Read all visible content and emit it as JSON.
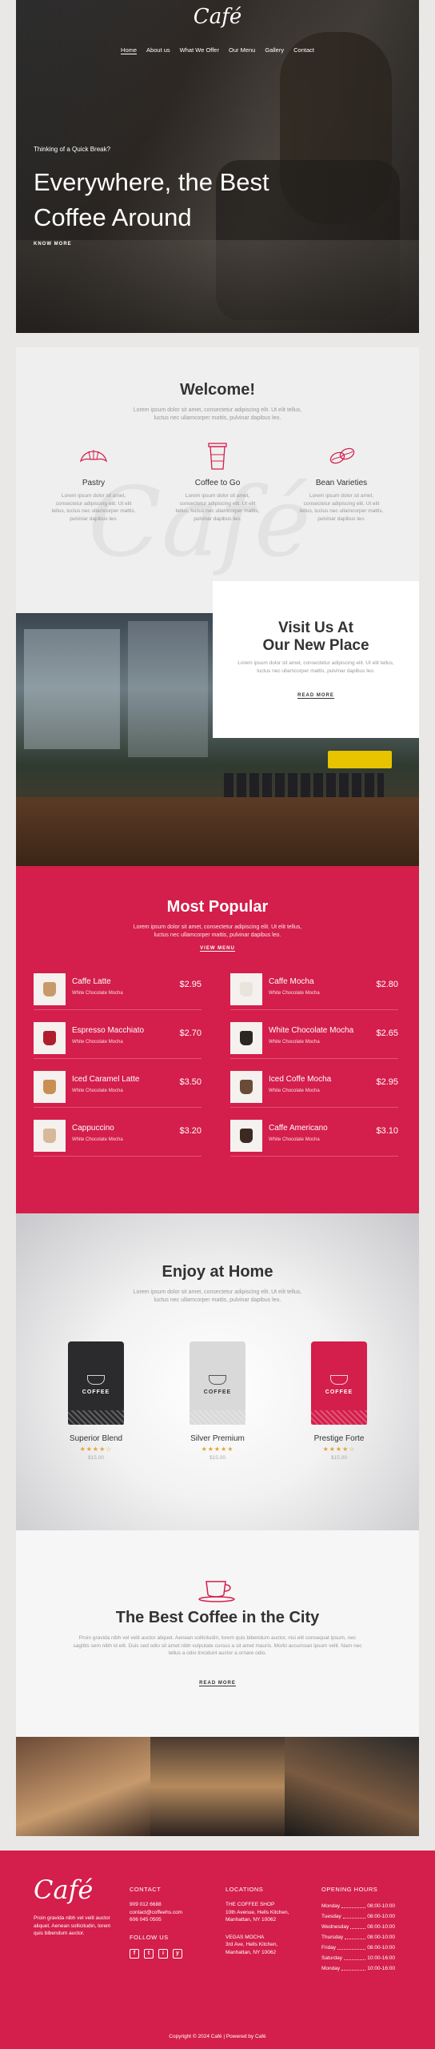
{
  "brand": {
    "logo_text": "Café"
  },
  "nav": {
    "items": [
      "Home",
      "About us",
      "What We Offer",
      "Our Menu",
      "Gallery",
      "Contact"
    ]
  },
  "hero": {
    "kicker": "Thinking of a Quick Break?",
    "title": "Everywhere, the Best Coffee Around",
    "link": "KNOW MORE"
  },
  "welcome": {
    "title": "Welcome!",
    "subtitle": "Lorem ipsum dolor sit amet, consectetur adipiscing elit. Ut elit tellus, luctus nec ullamcorper mattis, pulvinar dapibus leo.",
    "watermark": "Café",
    "features": [
      {
        "name": "Pastry",
        "desc": "Lorem ipsum dolor sit amet, consectetur adipiscing elit. Ut elit tellus, luctus nec ullamcorper mattis, pulvinar dapibus leo.",
        "icon": "croissant-icon"
      },
      {
        "name": "Coffee to Go",
        "desc": "Lorem ipsum dolor sit amet, consectetur adipiscing elit. Ut elit tellus, luctus nec ullamcorper mattis, pulvinar dapibus leo.",
        "icon": "takeaway-cup-icon"
      },
      {
        "name": "Bean Varieties",
        "desc": "Lorem ipsum dolor sit amet, consectetur adipiscing elit. Ut elit tellus, luctus nec ullamcorper mattis, pulvinar dapibus leo.",
        "icon": "coffee-beans-icon"
      }
    ]
  },
  "visit": {
    "title_line1": "Visit Us At",
    "title_line2": "Our New Place",
    "desc": "Lorem ipsum dolor sit amet, consectetur adipiscing elit. Ut elit tellus, luctus nec ullamcorper mattis, pulvinar dapibus leo.",
    "link": "READ MORE"
  },
  "menu": {
    "title": "Most Popular",
    "subtitle": "Lorem ipsum dolor sit amet, consectetur adipiscing elit. Ut elit tellus, luctus nec ullamcorper mattis, pulvinar dapibus leo.",
    "link": "VIEW MENU",
    "items": [
      {
        "name": "Caffe Latte",
        "desc": "White Chocolate Mocha",
        "price": "$2.95",
        "cup": "#c89a6a"
      },
      {
        "name": "Caffe Mocha",
        "desc": "White Chocolate Mocha",
        "price": "$2.80",
        "cup": "#e9e4dc"
      },
      {
        "name": "Espresso Macchiato",
        "desc": "White Chocolate Mocha",
        "price": "$2.70",
        "cup": "#b01e2b"
      },
      {
        "name": "White Chocolate Mocha",
        "desc": "White Chocolate Mocha",
        "price": "$2.65",
        "cup": "#2b2622"
      },
      {
        "name": "Iced Caramel Latte",
        "desc": "White Chocolate Mocha",
        "price": "$3.50",
        "cup": "#c98f52"
      },
      {
        "name": "Iced Coffe Mocha",
        "desc": "White Chocolate Mocha",
        "price": "$2.95",
        "cup": "#6a4b38"
      },
      {
        "name": "Cappuccino",
        "desc": "White Chocolate Mocha",
        "price": "$3.20",
        "cup": "#d7b99a"
      },
      {
        "name": "Caffe Americano",
        "desc": "White Chocolate Mocha",
        "price": "$3.10",
        "cup": "#3a2a22"
      }
    ]
  },
  "home": {
    "title": "Enjoy at Home",
    "subtitle": "Lorem ipsum dolor sit amet, consectetur adipiscing elit. Ut elit tellus, luctus nec ullamcorper mattis, pulvinar dapibus leo.",
    "bag_label": "COFFEE",
    "products": [
      {
        "name": "Superior Blend",
        "stars": "★★★★☆",
        "rating": 4,
        "price": "$15.00",
        "color": "#2b2b2d"
      },
      {
        "name": "Silver Premium",
        "stars": "★★★★★",
        "rating": 5,
        "price": "$15.00",
        "color": "#d9d9d9"
      },
      {
        "name": "Prestige Forte",
        "stars": "★★★★☆",
        "rating": 4,
        "price": "$15.00",
        "color": "#d41e4b"
      }
    ]
  },
  "city": {
    "title": "The Best Coffee in the City",
    "desc": "Proin gravida nibh vel velit auctor aliquet. Aenean sollicitudin, lorem quis bibendum auctor, nisi elit consequat ipsum, nec sagittis sem nibh id elit. Duis sed odio sit amet nibh vulputate cursus a sit amet mauris. Morbi accumsan ipsum velit. Nam nec tellus a odio tincidunt auctor a ornare odio.",
    "link": "READ MORE"
  },
  "footer": {
    "logo_text": "Café",
    "about": "Proin gravida nibh vel velit auctor aliquet. Aenean sollicitudin, lorem quis bibendum auctor.",
    "contact": {
      "heading": "CONTACT",
      "phone": "909 012 6688",
      "email": "contact@coffeehs.com",
      "phone2": "606 045 0505"
    },
    "follow": {
      "heading": "FOLLOW US",
      "icons": [
        "f",
        "t",
        "i",
        "y"
      ]
    },
    "locations": {
      "heading": "LOCATIONS",
      "shop1": "THE COFFEE SHOP",
      "shop1_addr1": "10th Avenue, Hells Kitchen,",
      "shop1_addr2": "Manhattan, NY 10062",
      "shop2": "VEGAS MOCHA",
      "shop2_addr1": "3rd Ave, Hells Kitchen,",
      "shop2_addr2": "Manhattan, NY 10062"
    },
    "hours": {
      "heading": "OPENING HOURS",
      "rows": [
        {
          "day": "Monday",
          "time": "08:00-10:00"
        },
        {
          "day": "Tuesday",
          "time": "08:00-10:00"
        },
        {
          "day": "Wednesday",
          "time": "08:00-10:00"
        },
        {
          "day": "Thursday",
          "time": "08:00-10:00"
        },
        {
          "day": "Friday",
          "time": "08:00-10:00"
        },
        {
          "day": "Saturday",
          "time": "10:00-16:00"
        },
        {
          "day": "Monday",
          "time": "10:00-16:00"
        }
      ]
    },
    "copyright": "Copyright © 2024 Café | Powered by Café"
  },
  "colors": {
    "accent": "#d41e4b",
    "star": "#e2a23a"
  }
}
